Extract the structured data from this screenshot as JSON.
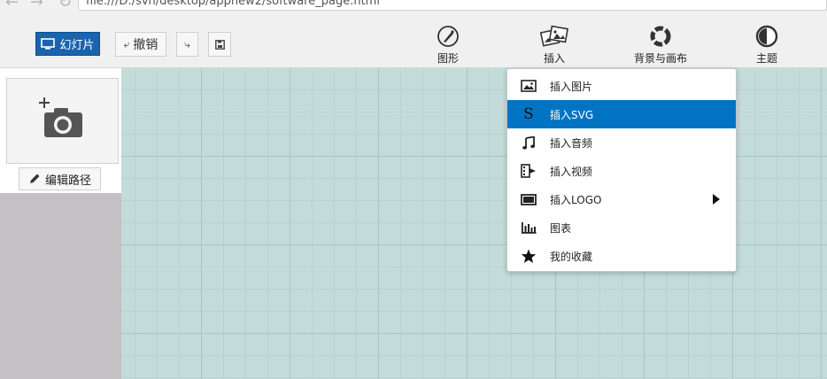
{
  "browser": {
    "url": "file:///D:/svn/desktop/appnew2/software_page.html"
  },
  "toolbar": {
    "slides_label": "幻灯片",
    "undo_label": "撤销",
    "tools": [
      {
        "label": "图形",
        "icon": "compass-icon"
      },
      {
        "label": "插入",
        "icon": "images-icon"
      },
      {
        "label": "背景与画布",
        "icon": "ring-icon"
      },
      {
        "label": "主题",
        "icon": "contrast-icon"
      }
    ]
  },
  "left_panel": {
    "edit_path_label": "编辑路径"
  },
  "insert_menu": {
    "items": [
      {
        "label": "插入图片",
        "icon": "picture-icon",
        "selected": false
      },
      {
        "label": "插入SVG",
        "icon": "svg-s-icon",
        "selected": true
      },
      {
        "label": "插入音频",
        "icon": "music-note-icon",
        "selected": false
      },
      {
        "label": "插入视频",
        "icon": "video-icon",
        "selected": false
      },
      {
        "label": "插入LOGO",
        "icon": "logo-rect-icon",
        "selected": false,
        "has_submenu": true
      },
      {
        "label": "图表",
        "icon": "bar-chart-icon",
        "selected": false
      },
      {
        "label": "我的收藏",
        "icon": "star-icon",
        "selected": false
      }
    ]
  },
  "colors": {
    "accent": "#1a63ae",
    "menu_selected": "#0074c2",
    "canvas_bg": "#c3dcd9"
  }
}
